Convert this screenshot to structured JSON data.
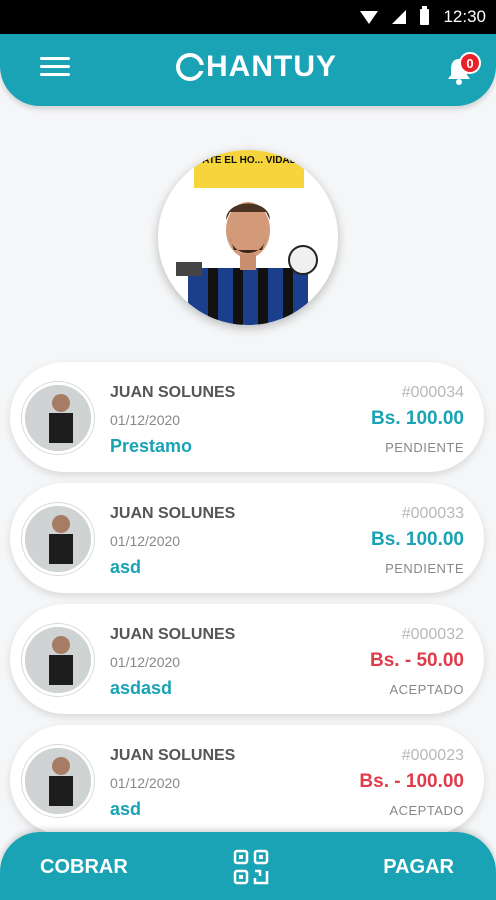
{
  "status_bar": {
    "time": "12:30"
  },
  "header": {
    "logo_text": "HANTUY",
    "notifications_count": "0"
  },
  "profile": {
    "banner_text": "ATE EL HO... VIDAL"
  },
  "transactions": [
    {
      "name": "JUAN SOLUNES",
      "date": "01/12/2020",
      "concept": "Prestamo",
      "id": "#000034",
      "amount": "Bs. 100.00",
      "status": "PENDIENTE",
      "amount_color": "#1aa3b4"
    },
    {
      "name": "JUAN SOLUNES",
      "date": "01/12/2020",
      "concept": "asd",
      "id": "#000033",
      "amount": "Bs. 100.00",
      "status": "PENDIENTE",
      "amount_color": "#1aa3b4"
    },
    {
      "name": "JUAN SOLUNES",
      "date": "01/12/2020",
      "concept": "asdasd",
      "id": "#000032",
      "amount": "Bs. - 50.00",
      "status": "ACEPTADO",
      "amount_color": "#e03b4a"
    },
    {
      "name": "JUAN SOLUNES",
      "date": "01/12/2020",
      "concept": "asd",
      "id": "#000023",
      "amount": "Bs. - 100.00",
      "status": "ACEPTADO",
      "amount_color": "#e03b4a"
    }
  ],
  "bottom_bar": {
    "left_label": "COBRAR",
    "right_label": "PAGAR"
  },
  "colors": {
    "brand": "#1aa3b4",
    "negative": "#e03b4a",
    "badge": "#e8202a"
  }
}
